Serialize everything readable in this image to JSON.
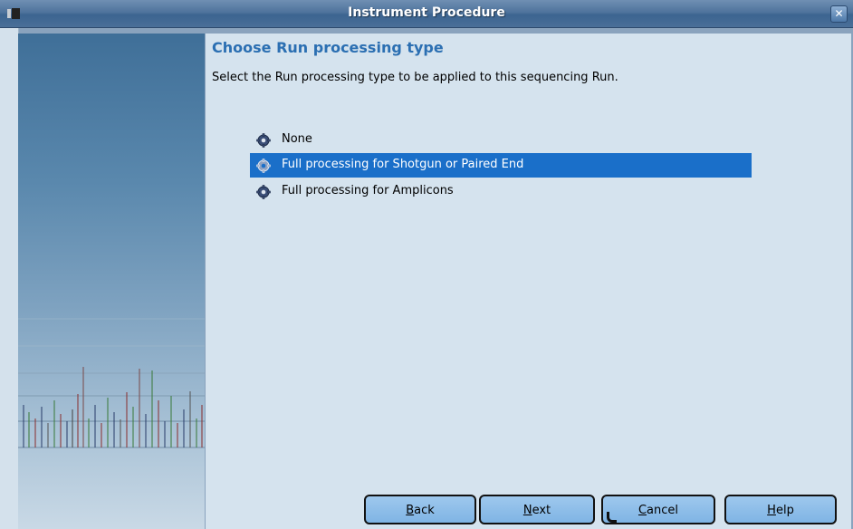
{
  "window": {
    "title": "Instrument Procedure",
    "close_icon": "close-icon",
    "app_icon": "window-icon"
  },
  "page": {
    "heading": "Choose Run processing type",
    "description": "Select the Run processing type to be applied to this sequencing Run."
  },
  "options": [
    {
      "label": "None",
      "icon": "gear-icon",
      "selected": false
    },
    {
      "label": "Full processing for Shotgun or Paired End",
      "icon": "gear-icon",
      "selected": true
    },
    {
      "label": "Full processing for Amplicons",
      "icon": "gear-icon",
      "selected": false
    }
  ],
  "buttons": {
    "back": {
      "mnemonic": "B",
      "rest": "ack"
    },
    "next": {
      "mnemonic": "N",
      "rest": "ext"
    },
    "cancel": {
      "mnemonic": "C",
      "rest": "ancel"
    },
    "help": {
      "mnemonic": "H",
      "rest": "elp"
    }
  },
  "colors": {
    "accent": "#2b6fb2",
    "selection": "#1a6fc9",
    "titlebar": "#4f739c",
    "button": "#8fbde9"
  }
}
